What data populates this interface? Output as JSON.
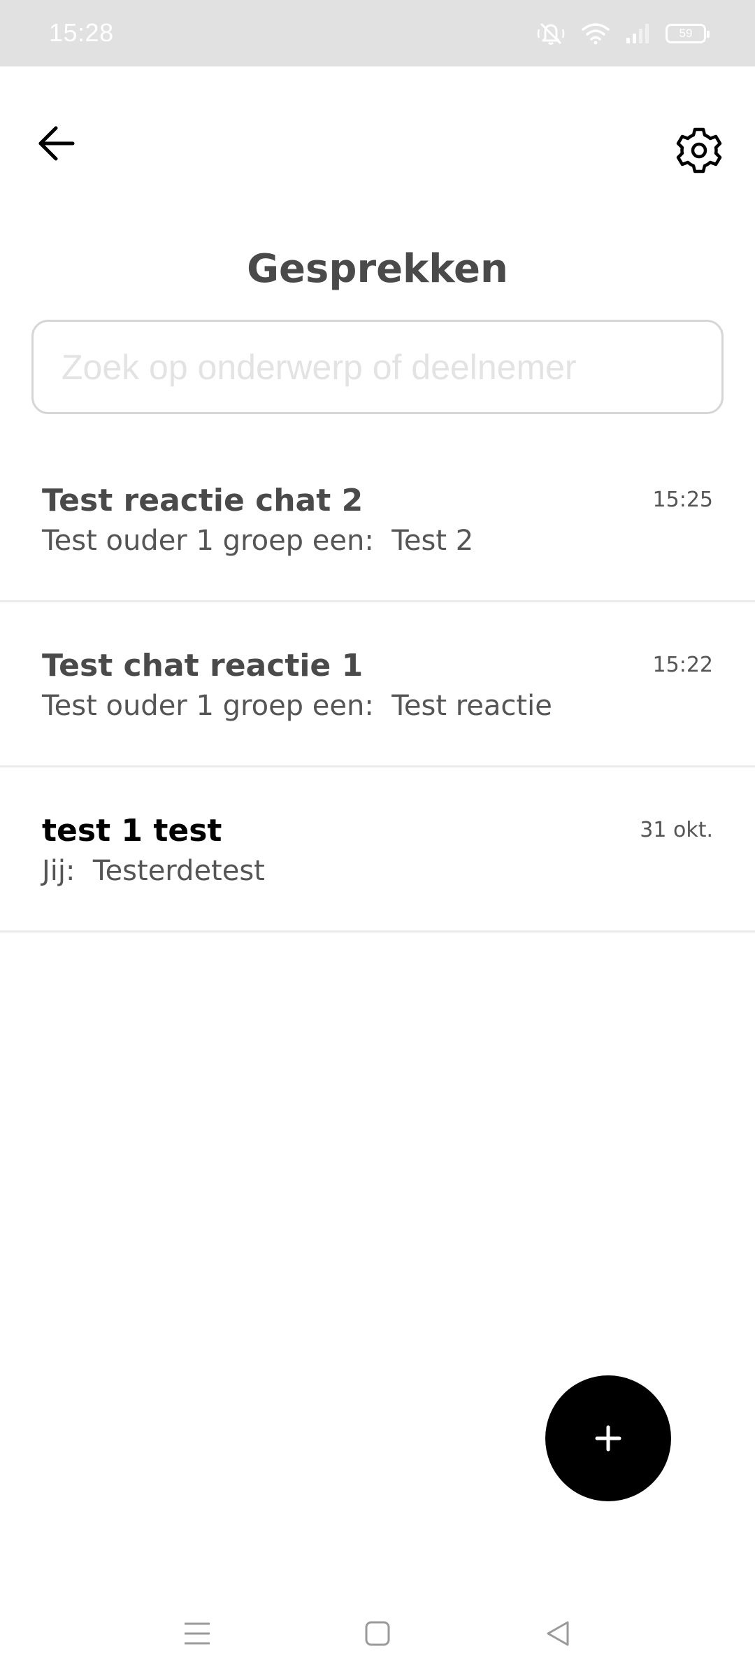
{
  "status_bar": {
    "time": "15:28",
    "battery": "59",
    "icons": [
      "mute-icon",
      "wifi-icon",
      "signal-icon",
      "battery-icon"
    ]
  },
  "header": {
    "title": "Gesprekken",
    "back_icon": "arrow-left-icon",
    "settings_icon": "gear-icon"
  },
  "search": {
    "placeholder": "Zoek op onderwerp of deelnemer",
    "value": ""
  },
  "conversations": [
    {
      "title": "Test reactie chat 2",
      "preview": "Test ouder 1 groep een:  Test 2",
      "time": "15:25",
      "unread": false
    },
    {
      "title": "Test chat reactie 1",
      "preview": "Test ouder 1 groep een:  Test reactie",
      "time": "15:22",
      "unread": false
    },
    {
      "title": "test 1 test",
      "preview": "Jij:  Testerdetest",
      "time": "31 okt.",
      "unread": true
    }
  ],
  "fab": {
    "icon": "plus-icon"
  },
  "nav_bar": {
    "icons": [
      "menu-icon",
      "home-square-icon",
      "back-triangle-icon"
    ]
  },
  "colors": {
    "status_bar_bg": "#e1e1e1",
    "title_text": "#4a4a4a",
    "fab_bg": "#000000",
    "divider": "#ebebeb"
  }
}
